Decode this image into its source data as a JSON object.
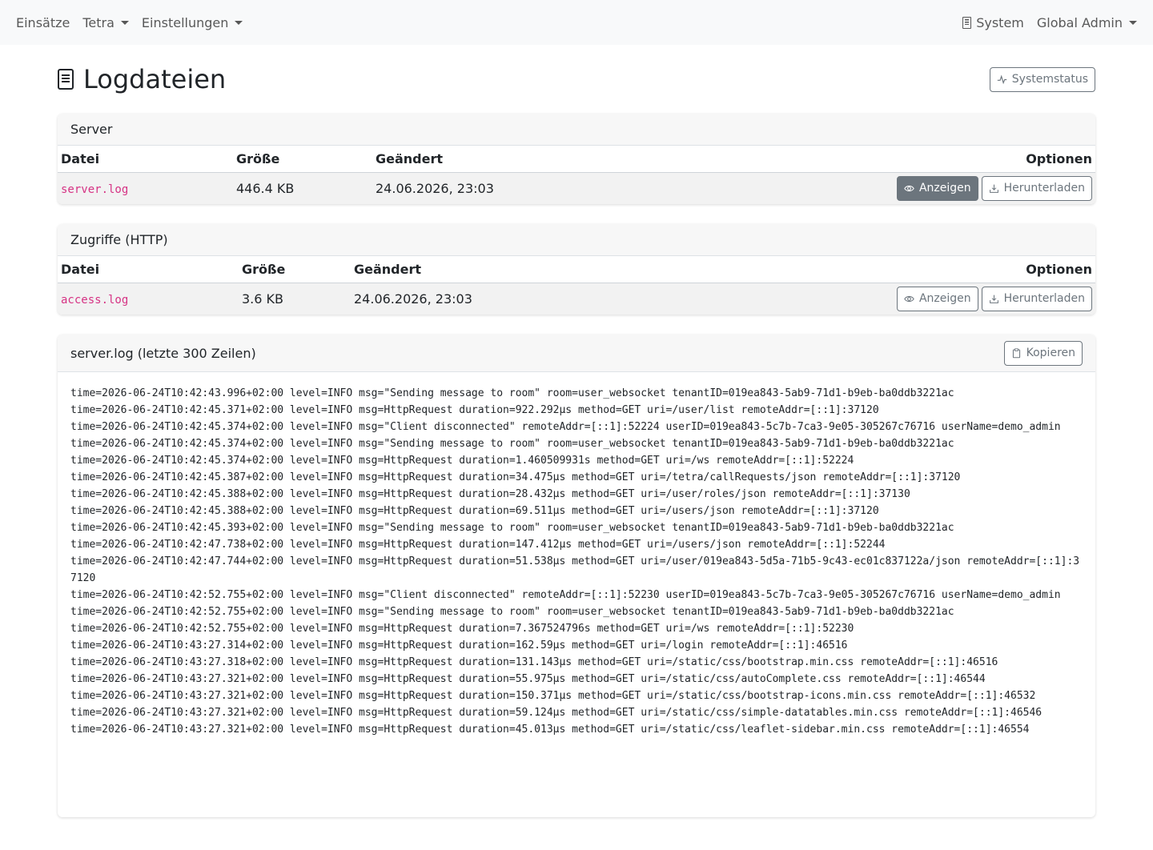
{
  "nav": {
    "left": [
      {
        "label": "Einsätze",
        "dropdown": false
      },
      {
        "label": "Tetra",
        "dropdown": true
      },
      {
        "label": "Einstellungen",
        "dropdown": true
      }
    ],
    "system": "System",
    "user": "Global Admin"
  },
  "page": {
    "title": "Logdateien",
    "systemstatus_label": "Systemstatus"
  },
  "server": {
    "title": "Server",
    "headers": [
      "Datei",
      "Größe",
      "Geändert",
      "Optionen"
    ],
    "row": {
      "file": "server.log",
      "size": "446.4 KB",
      "modified": "24.06.2026, 23:03",
      "view": "Anzeigen",
      "download": "Herunterladen"
    }
  },
  "access": {
    "title": "Zugriffe (HTTP)",
    "headers": [
      "Datei",
      "Größe",
      "Geändert",
      "Optionen"
    ],
    "row": {
      "file": "access.log",
      "size": "3.6 KB",
      "modified": "24.06.2026, 23:03",
      "view": "Anzeigen",
      "download": "Herunterladen"
    }
  },
  "log": {
    "title": "server.log (letzte 300 Zeilen)",
    "copy_label": "Kopieren",
    "lines": [
      "time=2026-06-24T10:42:43.996+02:00 level=INFO msg=\"Sending message to room\" room=user_websocket tenantID=019ea843-5ab9-71d1-b9eb-ba0ddb3221ac",
      "time=2026-06-24T10:42:45.371+02:00 level=INFO msg=HttpRequest duration=922.292µs method=GET uri=/user/list remoteAddr=[::1]:37120",
      "time=2026-06-24T10:42:45.374+02:00 level=INFO msg=\"Client disconnected\" remoteAddr=[::1]:52224 userID=019ea843-5c7b-7ca3-9e05-305267c76716 userName=demo_admin",
      "time=2026-06-24T10:42:45.374+02:00 level=INFO msg=\"Sending message to room\" room=user_websocket tenantID=019ea843-5ab9-71d1-b9eb-ba0ddb3221ac",
      "time=2026-06-24T10:42:45.374+02:00 level=INFO msg=HttpRequest duration=1.460509931s method=GET uri=/ws remoteAddr=[::1]:52224",
      "time=2026-06-24T10:42:45.387+02:00 level=INFO msg=HttpRequest duration=34.475µs method=GET uri=/tetra/callRequests/json remoteAddr=[::1]:37120",
      "time=2026-06-24T10:42:45.388+02:00 level=INFO msg=HttpRequest duration=28.432µs method=GET uri=/user/roles/json remoteAddr=[::1]:37130",
      "time=2026-06-24T10:42:45.388+02:00 level=INFO msg=HttpRequest duration=69.511µs method=GET uri=/users/json remoteAddr=[::1]:37120",
      "time=2026-06-24T10:42:45.393+02:00 level=INFO msg=\"Sending message to room\" room=user_websocket tenantID=019ea843-5ab9-71d1-b9eb-ba0ddb3221ac",
      "time=2026-06-24T10:42:47.738+02:00 level=INFO msg=HttpRequest duration=147.412µs method=GET uri=/users/json remoteAddr=[::1]:52244",
      "time=2026-06-24T10:42:47.744+02:00 level=INFO msg=HttpRequest duration=51.538µs method=GET uri=/user/019ea843-5d5a-71b5-9c43-ec01c837122a/json remoteAddr=[::1]:37120",
      "time=2026-06-24T10:42:52.755+02:00 level=INFO msg=\"Client disconnected\" remoteAddr=[::1]:52230 userID=019ea843-5c7b-7ca3-9e05-305267c76716 userName=demo_admin",
      "time=2026-06-24T10:42:52.755+02:00 level=INFO msg=\"Sending message to room\" room=user_websocket tenantID=019ea843-5ab9-71d1-b9eb-ba0ddb3221ac",
      "time=2026-06-24T10:42:52.755+02:00 level=INFO msg=HttpRequest duration=7.367524796s method=GET uri=/ws remoteAddr=[::1]:52230",
      "time=2026-06-24T10:43:27.314+02:00 level=INFO msg=HttpRequest duration=162.59µs method=GET uri=/login remoteAddr=[::1]:46516",
      "time=2026-06-24T10:43:27.318+02:00 level=INFO msg=HttpRequest duration=131.143µs method=GET uri=/static/css/bootstrap.min.css remoteAddr=[::1]:46516",
      "time=2026-06-24T10:43:27.321+02:00 level=INFO msg=HttpRequest duration=55.975µs method=GET uri=/static/css/autoComplete.css remoteAddr=[::1]:46544",
      "time=2026-06-24T10:43:27.321+02:00 level=INFO msg=HttpRequest duration=150.371µs method=GET uri=/static/css/bootstrap-icons.min.css remoteAddr=[::1]:46532",
      "time=2026-06-24T10:43:27.321+02:00 level=INFO msg=HttpRequest duration=59.124µs method=GET uri=/static/css/simple-datatables.min.css remoteAddr=[::1]:46546",
      "time=2026-06-24T10:43:27.321+02:00 level=INFO msg=HttpRequest duration=45.013µs method=GET uri=/static/css/leaflet-sidebar.min.css remoteAddr=[::1]:46554"
    ]
  },
  "colors": {
    "navbar_bg": "#f8f9fa",
    "secondary": "#6c757d",
    "code": "#d63384"
  }
}
